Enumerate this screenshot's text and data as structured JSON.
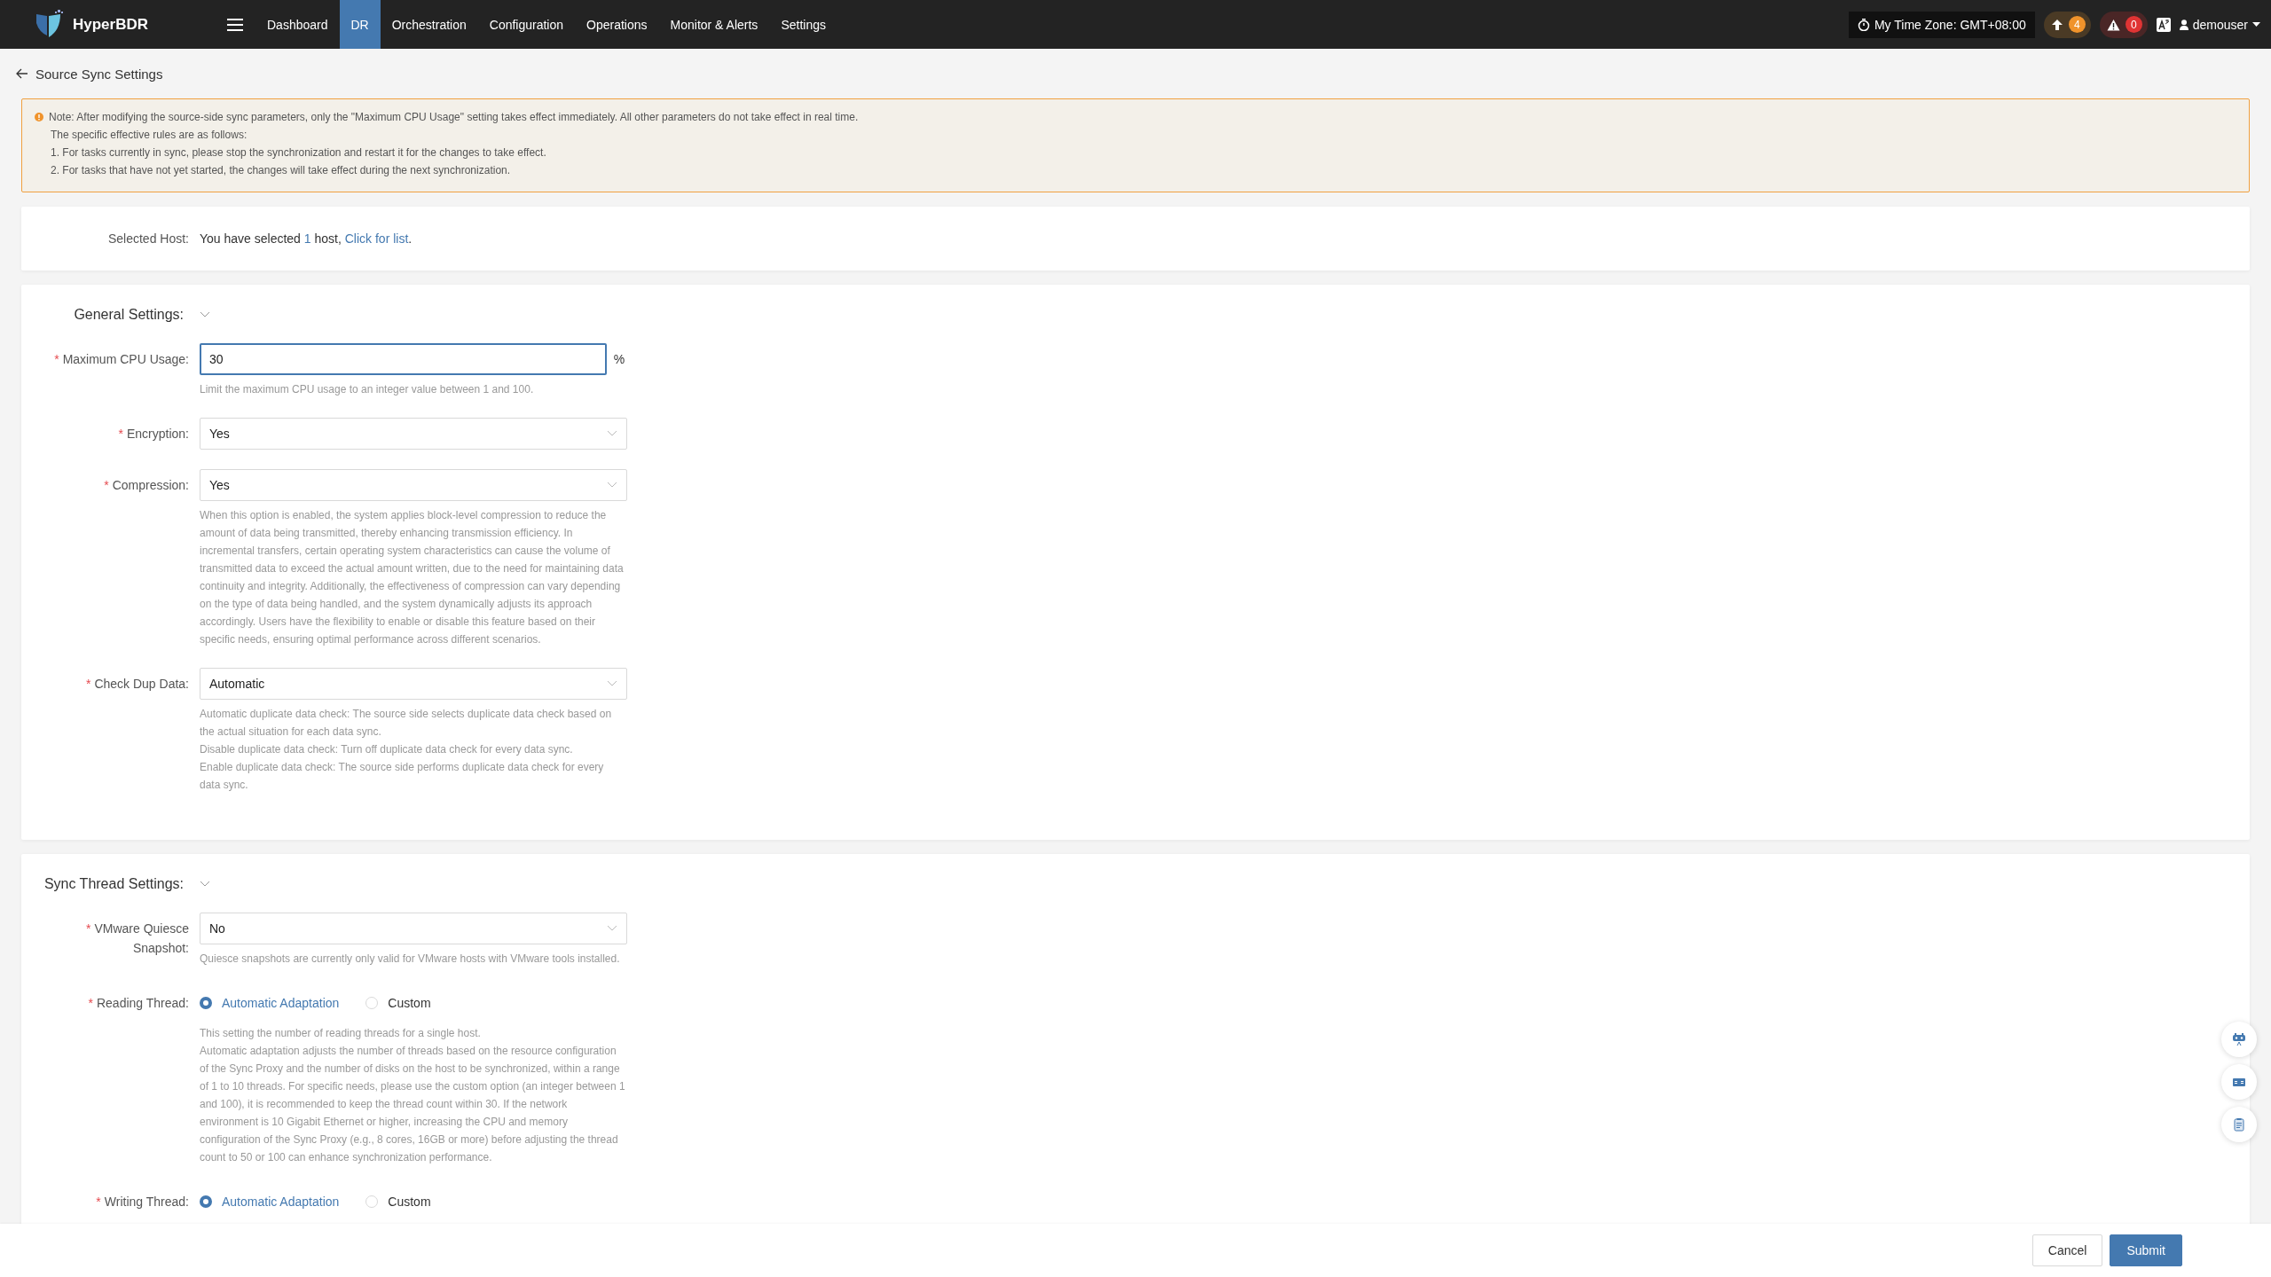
{
  "nav": {
    "brand": "HyperBDR",
    "items": [
      {
        "label": "Dashboard",
        "selected": false
      },
      {
        "label": "DR",
        "selected": true
      },
      {
        "label": "Orchestration",
        "selected": false
      },
      {
        "label": "Configuration",
        "selected": false
      },
      {
        "label": "Operations",
        "selected": false
      },
      {
        "label": "Monitor & Alerts",
        "selected": false
      },
      {
        "label": "Settings",
        "selected": false
      }
    ],
    "timezone": "My Time Zone: GMT+08:00",
    "upload_count": "4",
    "alert_count": "0",
    "user": "demouser"
  },
  "page": {
    "title": "Source Sync Settings"
  },
  "required_mark": "*",
  "note": {
    "lines": [
      "Note: After modifying the source-side sync parameters, only the \"Maximum CPU Usage\" setting takes effect immediately. All other parameters do not take effect in real time.",
      "The specific effective rules are as follows:",
      "1. For tasks currently in sync, please stop the synchronization and restart it for the changes to take effect.",
      "2. For tasks that have not yet started, the changes will take effect during the next synchronization."
    ]
  },
  "selected_host": {
    "label": "Selected Host:",
    "text_before": "You have selected ",
    "count": "1",
    "text_after": " host, ",
    "link": "Click for list",
    "text_end": "."
  },
  "sections": [
    {
      "title": "General Settings:",
      "expanded": true,
      "fields": [
        {
          "kind": "input",
          "label": "Maximum CPU Usage:",
          "required": true,
          "value": "30",
          "unit": "%",
          "focused": true,
          "help": [
            "Limit the maximum CPU usage to an integer value between 1 and 100."
          ]
        },
        {
          "kind": "select",
          "label": "Encryption:",
          "required": true,
          "value": "Yes"
        },
        {
          "kind": "select",
          "label": "Compression:",
          "required": true,
          "value": "Yes",
          "help": [
            "When this option is enabled, the system applies block-level compression to reduce the amount of data being transmitted, thereby enhancing transmission efficiency. In incremental transfers, certain operating system characteristics can cause the volume of transmitted data to exceed the actual amount written, due to the need for maintaining data continuity and integrity. Additionally, the effectiveness of compression can vary depending on the type of data being handled, and the system dynamically adjusts its approach accordingly. Users have the flexibility to enable or disable this feature based on their specific needs, ensuring optimal performance across different scenarios."
          ]
        },
        {
          "kind": "select",
          "label": "Check Dup Data:",
          "required": true,
          "value": "Automatic",
          "help": [
            "Automatic duplicate data check: The source side selects duplicate data check based on the actual situation for each data sync.",
            "Disable duplicate data check: Turn off duplicate data check for every data sync.",
            "Enable duplicate data check: The source side performs duplicate data check for every data sync."
          ]
        }
      ]
    },
    {
      "title": "Sync Thread Settings:",
      "expanded": true,
      "fields": [
        {
          "kind": "select",
          "label": "VMware Quiesce Snapshot:",
          "required": true,
          "value": "No",
          "help": [
            "Quiesce snapshots are currently only valid for VMware hosts with VMware tools installed."
          ]
        },
        {
          "kind": "radio",
          "label": "Reading Thread:",
          "required": true,
          "options": [
            {
              "label": "Automatic Adaptation",
              "selected": true
            },
            {
              "label": "Custom",
              "selected": false
            }
          ],
          "help": [
            "This setting the number of reading threads for a single host.",
            "Automatic adaptation adjusts the number of threads based on the resource configuration of the Sync Proxy and the number of disks on the host to be synchronized, within a range of 1 to 10 threads. For specific needs, please use the custom option (an integer between 1 and 100), it is recommended to keep the thread count within 30. If the network environment is 10 Gigabit Ethernet or higher, increasing the CPU and memory configuration of the Sync Proxy (e.g., 8 cores, 16GB or more) before adjusting the thread count to 50 or 100 can enhance synchronization performance."
          ]
        },
        {
          "kind": "radio",
          "label": "Writing Thread:",
          "required": true,
          "options": [
            {
              "label": "Automatic Adaptation",
              "selected": true
            },
            {
              "label": "Custom",
              "selected": false
            }
          ]
        }
      ]
    }
  ],
  "footer": {
    "buttons": [
      {
        "label": "Cancel",
        "kind": "default"
      },
      {
        "label": "Submit",
        "kind": "primary"
      }
    ]
  }
}
